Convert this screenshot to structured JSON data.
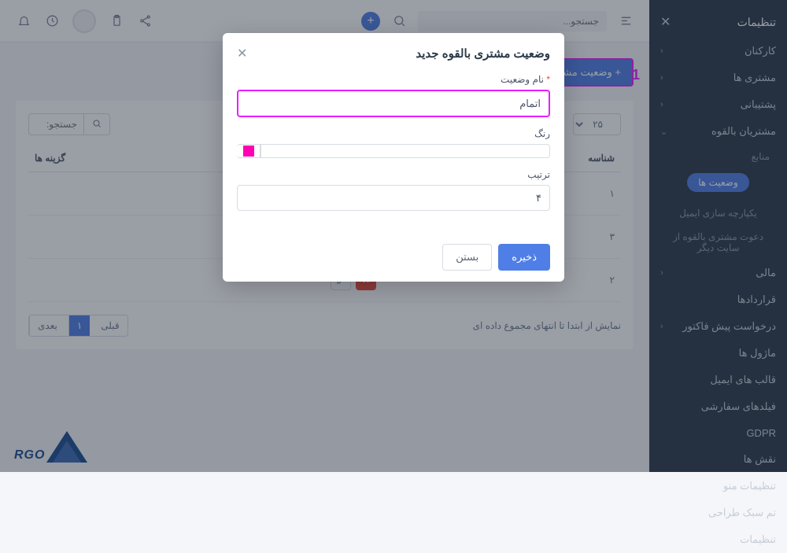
{
  "sidebar": {
    "title": "تنظیمات",
    "items": [
      {
        "label": "کارکنان",
        "chev": true
      },
      {
        "label": "مشتری ها",
        "chev": true
      },
      {
        "label": "پشتیبانی",
        "chev": true
      },
      {
        "label": "مشتریان بالقوه",
        "chev": true,
        "expanded": true
      },
      {
        "label": "مالی",
        "chev": true
      },
      {
        "label": "قراردادها"
      },
      {
        "label": "درخواست پیش فاکتور",
        "chev": true
      },
      {
        "label": "ماژول ها"
      },
      {
        "label": "قالب های ایمیل"
      },
      {
        "label": "فیلدهای سفارشی"
      },
      {
        "label": "GDPR"
      },
      {
        "label": "نقش ها"
      },
      {
        "label": "تنظیمات منو"
      },
      {
        "label": "تم سبک طراحی"
      },
      {
        "label": "تنظیمات"
      }
    ],
    "sub": {
      "sources": "منابع",
      "statuses": "وضعیت ها",
      "email_int": "یکپارچه سازی ایمیل",
      "invite": "دعوت مشتری بالقوه از سایت دیگر"
    }
  },
  "topbar": {
    "search_placeholder": "جستجو..."
  },
  "content": {
    "add_button": "+ وضعیت مشتری",
    "annotation": "1",
    "page_size": "۲۵",
    "search_placeholder": "جستجو:",
    "headers": {
      "id": "شناسه",
      "options": "گزینه ها"
    },
    "rows": [
      {
        "id": "۱",
        "deletable": false
      },
      {
        "id": "۳",
        "deletable": true
      },
      {
        "id": "۲",
        "deletable": true
      }
    ],
    "footer_info": "نمایش از ابتدا تا انتهای مجموع داده ای",
    "pager": {
      "prev": "قبلی",
      "page": "۱",
      "next": "بعدی"
    }
  },
  "modal": {
    "title": "وضعیت مشتری بالقوه جدید",
    "name_label": "نام وضعیت",
    "name_value": "اتمام",
    "color_label": "رنگ",
    "color_value": "#ff00b3",
    "order_label": "ترتیب",
    "order_value": "۴",
    "save": "ذخیره",
    "close": "بستن"
  },
  "logo": {
    "text": "RGO"
  }
}
